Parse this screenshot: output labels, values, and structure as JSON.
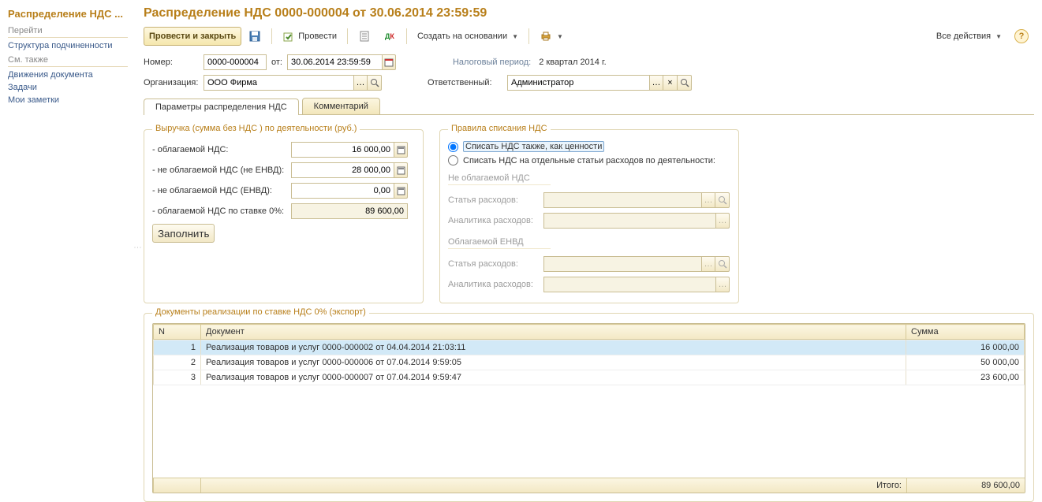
{
  "sidebar": {
    "title": "Распределение НДС ...",
    "section_goto": "Перейти",
    "goto_items": [
      "Структура подчиненности"
    ],
    "section_see_also": "См. также",
    "see_also_items": [
      "Движения документа",
      "Задачи",
      "Мои заметки"
    ]
  },
  "header": {
    "title": "Распределение НДС 0000-000004 от 30.06.2014 23:59:59"
  },
  "toolbar": {
    "post_and_close": "Провести и закрыть",
    "post": "Провести",
    "create_based_on": "Создать на основании",
    "all_actions": "Все действия"
  },
  "form": {
    "number_label": "Номер:",
    "number_value": "0000-000004",
    "from_label": "от:",
    "date_value": "30.06.2014 23:59:59",
    "tax_period_label": "Налоговый период:",
    "tax_period_value": "2 квартал 2014 г.",
    "org_label": "Организация:",
    "org_value": "ООО Фирма",
    "responsible_label": "Ответственный:",
    "responsible_value": "Администратор"
  },
  "tabs": {
    "params": "Параметры распределения НДС",
    "comment": "Комментарий"
  },
  "revenue": {
    "legend": "Выручка (сумма без НДС ) по деятельности (руб.)",
    "vat_label": "- облагаемой НДС:",
    "vat_value": "16 000,00",
    "no_vat_no_envd_label": "- не облагаемой НДС (не ЕНВД):",
    "no_vat_no_envd_value": "28 000,00",
    "no_vat_envd_label": "- не облагаемой НДС (ЕНВД):",
    "no_vat_envd_value": "0,00",
    "vat_zero_label": "- облагаемой НДС по ставке 0%:",
    "vat_zero_value": "89 600,00",
    "fill_btn": "Заполнить"
  },
  "rules": {
    "legend": "Правила списания НДС",
    "opt_same": "Списать НДС также, как ценности",
    "opt_separate": "Списать НДС на отдельные статьи расходов по деятельности:",
    "non_vat_legend": "Не облагаемой НДС",
    "envd_legend": "Облагаемой ЕНВД",
    "expense_item_label": "Статья расходов:",
    "expense_analytics_label": "Аналитика расходов:"
  },
  "docs": {
    "legend": "Документы реализации по ставке НДС 0% (экспорт)",
    "col_n": "N",
    "col_doc": "Документ",
    "col_sum": "Сумма",
    "rows": [
      {
        "n": "1",
        "doc": "Реализация товаров и услуг 0000-000002 от 04.04.2014 21:03:11",
        "sum": "16 000,00"
      },
      {
        "n": "2",
        "doc": "Реализация товаров и услуг 0000-000006 от 07.04.2014 9:59:05",
        "sum": "50 000,00"
      },
      {
        "n": "3",
        "doc": "Реализация товаров и услуг 0000-000007 от 07.04.2014 9:59:47",
        "sum": "23 600,00"
      }
    ],
    "total_label": "Итого:",
    "total_value": "89 600,00"
  }
}
